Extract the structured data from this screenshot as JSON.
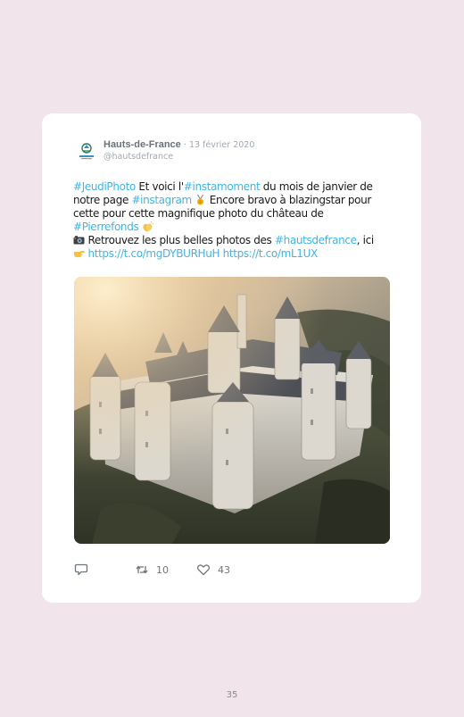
{
  "tweet": {
    "display_name": "Hauts-de-France",
    "separator": "·",
    "date": "13 février 2020",
    "handle": "@hautsdefrance",
    "text": {
      "l1_tag1": "#JeudiPhoto",
      "l1_t1": " Et voici l'",
      "l1_tag2": "#instamoment",
      "l1_t2": " du mois de janvier de",
      "l2_t1": "notre page ",
      "l2_tag1": "#instagram",
      "l2_t2": " Encore bravo à blazingstar pour",
      "l3_t1": "cette pour cette magnifique photo du château de",
      "l4_tag1": "#Pierrefonds",
      "l5_t1": " Retrouvez les plus belles photos des ",
      "l5_tag1": "#hautsdefrance",
      "l5_t2": ", ici",
      "l6_link1": "https://t.co/mgDYBURHuH",
      "l6_link2": "https://t.co/mL1UX"
    },
    "emojis": {
      "medal": "medal-emoji",
      "clap": "clapping-hands-emoji",
      "camera": "camera-emoji",
      "pointer": "pointing-right-emoji"
    },
    "photo": {
      "subject": "castle-photo"
    },
    "actions": {
      "reply_count": "",
      "retweet_count": "10",
      "like_count": "43"
    }
  },
  "colors": {
    "background": "#f1e4ea",
    "card": "#ffffff",
    "hashtag": "#3fb4e6",
    "muted": "#a2a9b0"
  },
  "page": {
    "number": "35"
  }
}
